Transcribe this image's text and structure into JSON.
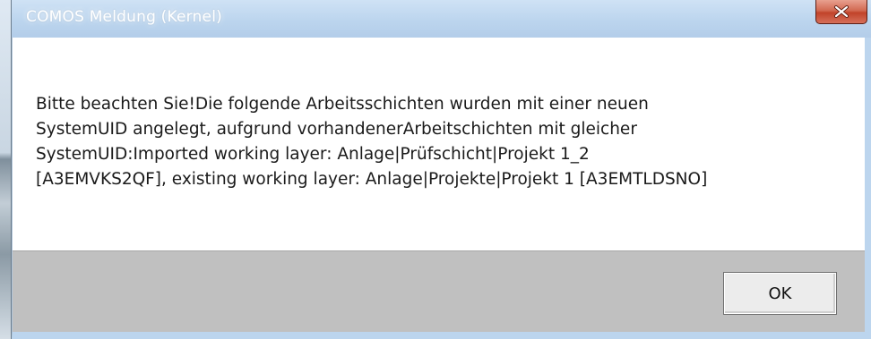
{
  "window": {
    "title": "COMOS Meldung (Kernel)",
    "close_icon": "close-icon"
  },
  "message": {
    "text": "Bitte beachten Sie!Die folgende Arbeitsschichten wurden mit einer neuen\nSystemUID angelegt, aufgrund vorhandenerArbeitschichten mit gleicher\nSystemUID:Imported working layer: Anlage|Prüfschicht|Projekt 1_2\n[A3EMVKS2QF], existing working layer: Anlage|Projekte|Projekt 1 [A3EMTLDSNO]"
  },
  "buttons": {
    "ok_label": "OK"
  },
  "colors": {
    "titlebar": "#bcd5ee",
    "close_button": "#c1432a",
    "button_area": "#c0c0c0"
  }
}
